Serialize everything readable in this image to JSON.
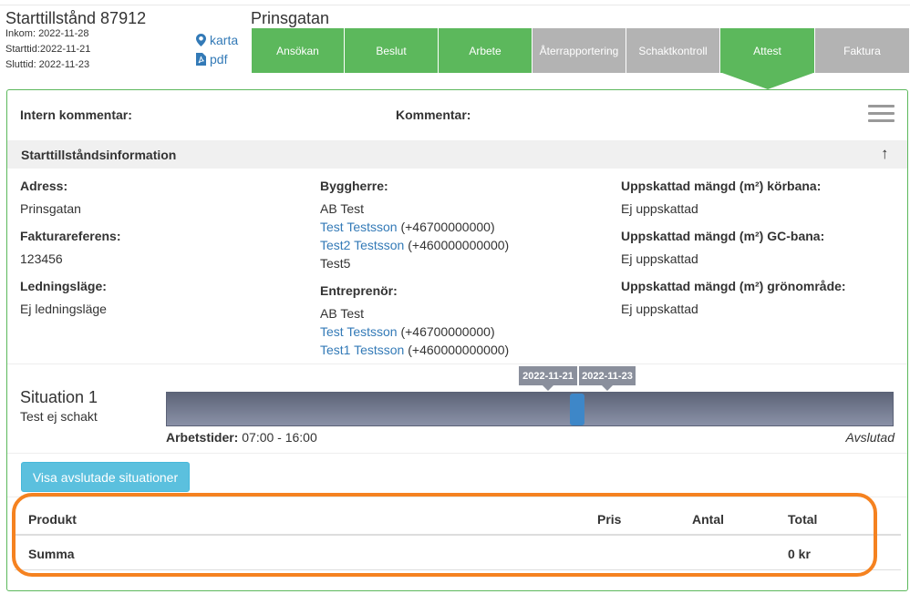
{
  "permit": {
    "title": "Starttillstånd 87912",
    "inkom": "Inkom:  2022-11-28",
    "starttid": "Starttid:2022-11-21",
    "sluttid": "Sluttid:  2022-11-23"
  },
  "links": {
    "karta": "karta",
    "pdf": "pdf"
  },
  "street": "Prinsgatan",
  "steps": [
    {
      "label": "Ansökan",
      "state": "done"
    },
    {
      "label": "Beslut",
      "state": "done"
    },
    {
      "label": "Arbete",
      "state": "done"
    },
    {
      "label": "Återrapportering",
      "state": "todo"
    },
    {
      "label": "Schaktkontroll",
      "state": "todo"
    },
    {
      "label": "Attest",
      "state": "current"
    },
    {
      "label": "Faktura",
      "state": "todo"
    }
  ],
  "comments": {
    "intern": "Intern kommentar:",
    "kommentar": "Kommentar:"
  },
  "section": {
    "title": "Starttillståndsinformation",
    "toggle": "↑"
  },
  "info": {
    "adress_label": "Adress:",
    "adress_value": "Prinsgatan",
    "faktura_label": "Fakturareferens:",
    "faktura_value": "123456",
    "ledning_label": "Ledningsläge:",
    "ledning_value": "Ej ledningsläge",
    "byggherre_label": "Byggherre:",
    "byggherre_company": "AB Test",
    "byggherre_contact1_name": "Test Testsson",
    "byggherre_contact1_phone": " (+46700000000)",
    "byggherre_contact2_name": "Test2 Testsson",
    "byggherre_contact2_phone": " (+460000000000)",
    "byggherre_extra": "Test5",
    "entreprenor_label": "Entreprenör:",
    "entreprenor_company": "AB Test",
    "entreprenor_contact1_name": "Test Testsson",
    "entreprenor_contact1_phone": " (+46700000000)",
    "entreprenor_contact2_name": "Test1 Testsson",
    "entreprenor_contact2_phone": " (+460000000000)",
    "korbana_label": "Uppskattad mängd (m²) körbana:",
    "korbana_value": "Ej uppskattad",
    "gc_label": "Uppskattad mängd (m²) GC-bana:",
    "gc_value": "Ej uppskattad",
    "gron_label": "Uppskattad mängd (m²) grönområde:",
    "gron_value": "Ej uppskattad"
  },
  "situation": {
    "title": "Situation 1",
    "subtitle": "Test ej schakt",
    "start_tag": "2022-11-21",
    "end_tag": "2022-11-23",
    "worktime_label": "Arbetstider:",
    "worktime_value": " 07:00 - 16:00",
    "status": "Avslutad"
  },
  "show_finished_button": "Visa avslutade situationer",
  "products": {
    "headers": {
      "produkt": "Produkt",
      "pris": "Pris",
      "antal": "Antal",
      "total": "Total"
    },
    "sum_label": "Summa",
    "sum_total": "0 kr"
  },
  "colors": {
    "done": "#5cb85c",
    "todo": "#b3b3b3",
    "link": "#337ab7",
    "highlight": "#f58220"
  }
}
